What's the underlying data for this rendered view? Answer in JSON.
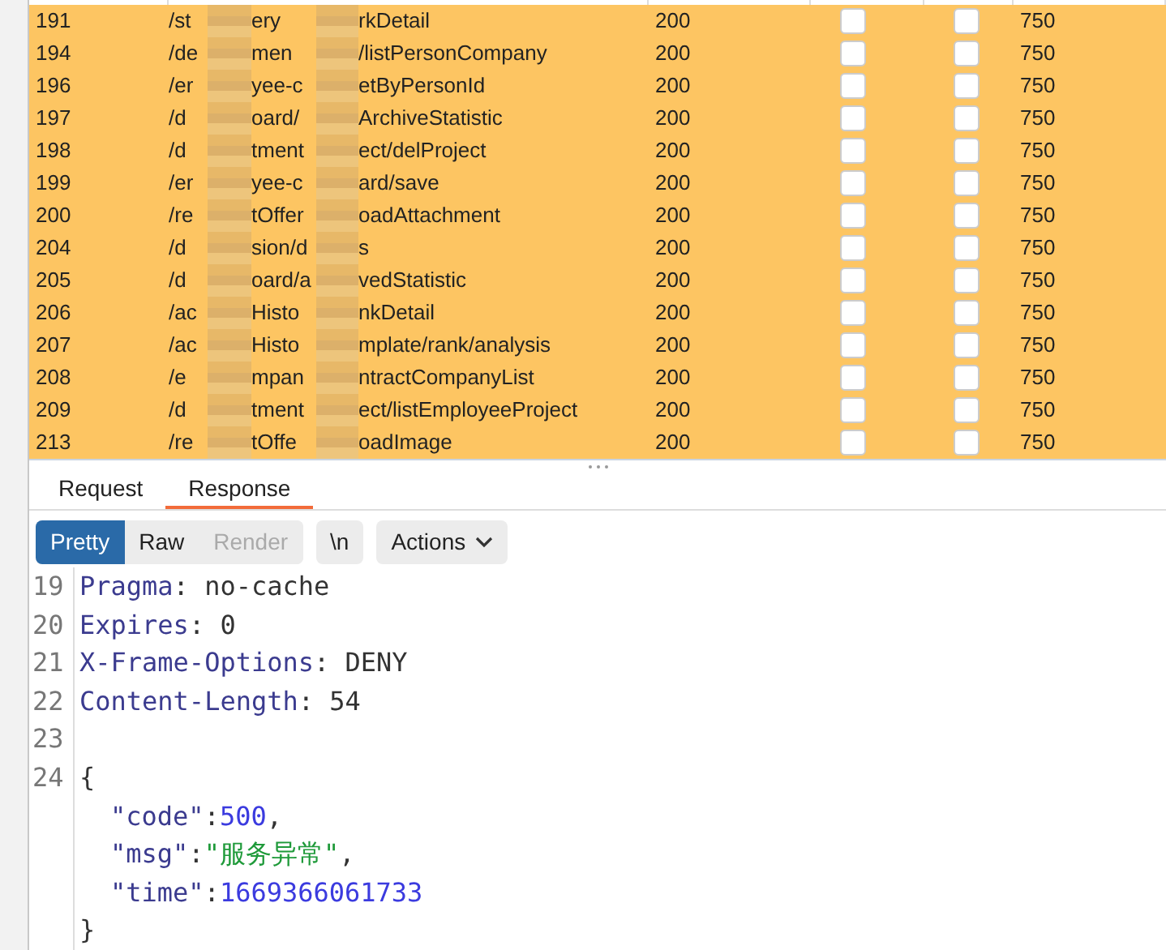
{
  "table": {
    "rows": [
      {
        "number": "191",
        "path": [
          "/st",
          "ery",
          "rkDetail"
        ],
        "status": "200",
        "checkbox_1": false,
        "checkbox_2": false,
        "length": "750"
      },
      {
        "number": "194",
        "path": [
          "/de",
          "men",
          "/listPersonCompany"
        ],
        "status": "200",
        "checkbox_1": false,
        "checkbox_2": false,
        "length": "750"
      },
      {
        "number": "196",
        "path": [
          "/er",
          "yee-c",
          "etByPersonId"
        ],
        "status": "200",
        "checkbox_1": false,
        "checkbox_2": false,
        "length": "750"
      },
      {
        "number": "197",
        "path": [
          "/d",
          "oard/",
          "ArchiveStatistic"
        ],
        "status": "200",
        "checkbox_1": false,
        "checkbox_2": false,
        "length": "750"
      },
      {
        "number": "198",
        "path": [
          "/d",
          "tment",
          "ect/delProject"
        ],
        "status": "200",
        "checkbox_1": false,
        "checkbox_2": false,
        "length": "750"
      },
      {
        "number": "199",
        "path": [
          "/er",
          "yee-c",
          "ard/save"
        ],
        "status": "200",
        "checkbox_1": false,
        "checkbox_2": false,
        "length": "750"
      },
      {
        "number": "200",
        "path": [
          "/re",
          "tOffer",
          "oadAttachment"
        ],
        "status": "200",
        "checkbox_1": false,
        "checkbox_2": false,
        "length": "750"
      },
      {
        "number": "204",
        "path": [
          "/d",
          "sion/d",
          "s"
        ],
        "status": "200",
        "checkbox_1": false,
        "checkbox_2": false,
        "length": "750"
      },
      {
        "number": "205",
        "path": [
          "/d",
          "oard/a",
          "vedStatistic"
        ],
        "status": "200",
        "checkbox_1": false,
        "checkbox_2": false,
        "length": "750"
      },
      {
        "number": "206",
        "path": [
          "/ac",
          "Histo",
          "nkDetail"
        ],
        "status": "200",
        "checkbox_1": false,
        "checkbox_2": false,
        "length": "750"
      },
      {
        "number": "207",
        "path": [
          "/ac",
          "Histo",
          "mplate/rank/analysis"
        ],
        "status": "200",
        "checkbox_1": false,
        "checkbox_2": false,
        "length": "750"
      },
      {
        "number": "208",
        "path": [
          "/e",
          "mpan",
          "ntractCompanyList"
        ],
        "status": "200",
        "checkbox_1": false,
        "checkbox_2": false,
        "length": "750"
      },
      {
        "number": "209",
        "path": [
          "/d",
          "tment",
          "ect/listEmployeeProject"
        ],
        "status": "200",
        "checkbox_1": false,
        "checkbox_2": false,
        "length": "750"
      },
      {
        "number": "213",
        "path": [
          "/re",
          "tOffe",
          "oadImage"
        ],
        "status": "200",
        "checkbox_1": false,
        "checkbox_2": false,
        "length": "750"
      }
    ]
  },
  "tabs": [
    {
      "label": "Request",
      "selected": false
    },
    {
      "label": "Response",
      "selected": true
    }
  ],
  "view_modes": [
    {
      "label": "Pretty",
      "selected": true,
      "disabled": false
    },
    {
      "label": "Raw",
      "selected": false,
      "disabled": false
    },
    {
      "label": "Render",
      "selected": false,
      "disabled": true
    }
  ],
  "newline_button": "\\n",
  "actions_button": "Actions",
  "code_lines": [
    {
      "number": "19",
      "tokens": [
        {
          "kind": "key",
          "text": "Pragma"
        },
        {
          "kind": "plain",
          "text": ": no-cache"
        }
      ]
    },
    {
      "number": "20",
      "tokens": [
        {
          "kind": "key",
          "text": "Expires"
        },
        {
          "kind": "plain",
          "text": ": 0"
        }
      ]
    },
    {
      "number": "21",
      "tokens": [
        {
          "kind": "key",
          "text": "X-Frame-Options"
        },
        {
          "kind": "plain",
          "text": ": DENY"
        }
      ]
    },
    {
      "number": "22",
      "tokens": [
        {
          "kind": "key",
          "text": "Content-Length"
        },
        {
          "kind": "plain",
          "text": ": 54"
        }
      ]
    },
    {
      "number": "23"
    },
    {
      "number": "24",
      "tokens": [
        {
          "kind": "plain",
          "text": "{"
        }
      ]
    },
    {
      "indented": true,
      "tokens": [
        {
          "kind": "key",
          "text": "\"code\""
        },
        {
          "kind": "plain",
          "text": ":"
        },
        {
          "kind": "number",
          "text": "500"
        },
        {
          "kind": "plain",
          "text": ","
        }
      ]
    },
    {
      "indented": true,
      "tokens": [
        {
          "kind": "key",
          "text": "\"msg\""
        },
        {
          "kind": "plain",
          "text": ":"
        },
        {
          "kind": "string",
          "text": "\"服务异常\""
        },
        {
          "kind": "plain",
          "text": ","
        }
      ]
    },
    {
      "indented": true,
      "tokens": [
        {
          "kind": "key",
          "text": "\"time\""
        },
        {
          "kind": "plain",
          "text": ":"
        },
        {
          "kind": "number",
          "text": "1669366061733"
        }
      ]
    },
    {
      "tokens": [
        {
          "kind": "plain",
          "text": "}"
        }
      ]
    }
  ]
}
